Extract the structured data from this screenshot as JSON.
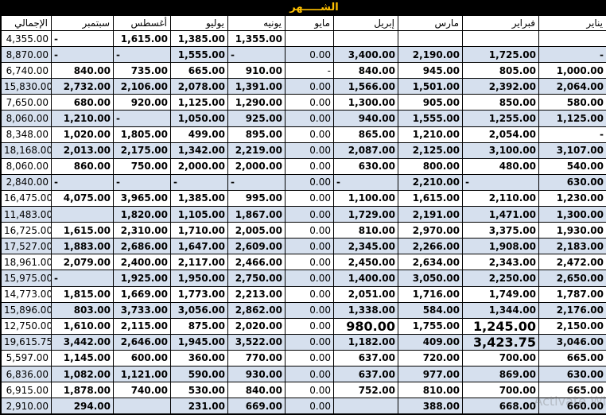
{
  "title": "الشـــــهر",
  "headers": [
    "الإجمالي",
    "سبتمبر",
    "أغسطس",
    "يوليو",
    "يونيه",
    "مايو",
    "إبريل",
    "مارس",
    "فبراير",
    "يناير"
  ],
  "rows": [
    [
      "4,355.00",
      "-",
      "1,615.00",
      "1,385.00",
      "1,355.00",
      "",
      "",
      "",
      "",
      ""
    ],
    [
      "8,870.00",
      "-",
      "-",
      "1,555.00",
      "-",
      "0.00",
      "3,400.00",
      "2,190.00",
      "1,725.00",
      "-"
    ],
    [
      "6,740.00",
      "840.00",
      "735.00",
      "665.00",
      "910.00",
      "-",
      "840.00",
      "945.00",
      "805.00",
      "1,000.00"
    ],
    [
      "15,830.00",
      "2,732.00",
      "2,106.00",
      "2,078.00",
      "1,391.00",
      "0.00",
      "1,566.00",
      "1,501.00",
      "2,392.00",
      "2,064.00"
    ],
    [
      "7,650.00",
      "680.00",
      "920.00",
      "1,125.00",
      "1,290.00",
      "0.00",
      "1,300.00",
      "905.00",
      "850.00",
      "580.00"
    ],
    [
      "8,060.00",
      "1,210.00",
      "-",
      "1,050.00",
      "925.00",
      "0.00",
      "940.00",
      "1,555.00",
      "1,255.00",
      "1,125.00"
    ],
    [
      "8,348.00",
      "1,020.00",
      "1,805.00",
      "499.00",
      "895.00",
      "0.00",
      "865.00",
      "1,210.00",
      "2,054.00",
      "-"
    ],
    [
      "18,168.00",
      "2,013.00",
      "2,175.00",
      "1,342.00",
      "2,219.00",
      "0.00",
      "2,087.00",
      "2,125.00",
      "3,100.00",
      "3,107.00"
    ],
    [
      "8,060.00",
      "860.00",
      "750.00",
      "2,000.00",
      "2,000.00",
      "0.00",
      "630.00",
      "800.00",
      "480.00",
      "540.00"
    ],
    [
      "2,840.00",
      "-",
      "-",
      "-",
      "-",
      "0.00",
      "-",
      "2,210.00",
      "-",
      "630.00"
    ],
    [
      "16,475.00",
      "4,075.00",
      "3,965.00",
      "1,385.00",
      "995.00",
      "0.00",
      "1,100.00",
      "1,615.00",
      "2,110.00",
      "1,230.00"
    ],
    [
      "11,483.00",
      "",
      "1,820.00",
      "1,105.00",
      "1,867.00",
      "0.00",
      "1,729.00",
      "2,191.00",
      "1,471.00",
      "1,300.00"
    ],
    [
      "16,725.00",
      "1,615.00",
      "2,310.00",
      "1,710.00",
      "2,005.00",
      "0.00",
      "810.00",
      "2,970.00",
      "3,375.00",
      "1,930.00"
    ],
    [
      "17,527.00",
      "1,883.00",
      "2,686.00",
      "1,647.00",
      "2,609.00",
      "0.00",
      "2,345.00",
      "2,266.00",
      "1,908.00",
      "2,183.00"
    ],
    [
      "18,961.00",
      "2,079.00",
      "2,400.00",
      "2,117.00",
      "2,466.00",
      "0.00",
      "2,450.00",
      "2,634.00",
      "2,343.00",
      "2,472.00"
    ],
    [
      "15,975.00",
      "-",
      "1,925.00",
      "1,950.00",
      "2,750.00",
      "0.00",
      "1,400.00",
      "3,050.00",
      "2,250.00",
      "2,650.00"
    ],
    [
      "14,773.00",
      "1,815.00",
      "1,669.00",
      "1,773.00",
      "2,213.00",
      "0.00",
      "2,051.00",
      "1,716.00",
      "1,749.00",
      "1,787.00"
    ],
    [
      "15,896.00",
      "803.00",
      "3,733.00",
      "3,056.00",
      "2,862.00",
      "0.00",
      "1,338.00",
      "584.00",
      "1,344.00",
      "2,176.00"
    ],
    [
      "12,750.00",
      "1,610.00",
      "2,115.00",
      "875.00",
      "2,020.00",
      "0.00",
      "980.00",
      "1,755.00",
      "1,245.00",
      "2,150.00"
    ],
    [
      "19,615.75",
      "3,442.00",
      "2,646.00",
      "1,945.00",
      "3,522.00",
      "0.00",
      "1,182.00",
      "409.00",
      "3,423.75",
      "3,046.00"
    ],
    [
      "5,597.00",
      "1,145.00",
      "600.00",
      "360.00",
      "770.00",
      "0.00",
      "637.00",
      "720.00",
      "700.00",
      "665.00"
    ],
    [
      "6,836.00",
      "1,082.00",
      "1,121.00",
      "590.00",
      "930.00",
      "0.00",
      "637.00",
      "977.00",
      "869.00",
      "630.00"
    ],
    [
      "6,915.00",
      "1,878.00",
      "740.00",
      "530.00",
      "840.00",
      "0.00",
      "752.00",
      "810.00",
      "700.00",
      "665.00"
    ],
    [
      "2,910.00",
      "294.00",
      "",
      "231.00",
      "669.00",
      "0.00",
      "",
      "388.00",
      "668.00",
      "660.00"
    ]
  ],
  "big_cells": [
    [
      18,
      6
    ],
    [
      18,
      8
    ],
    [
      19,
      8
    ]
  ],
  "watermark": "Activate Wi"
}
